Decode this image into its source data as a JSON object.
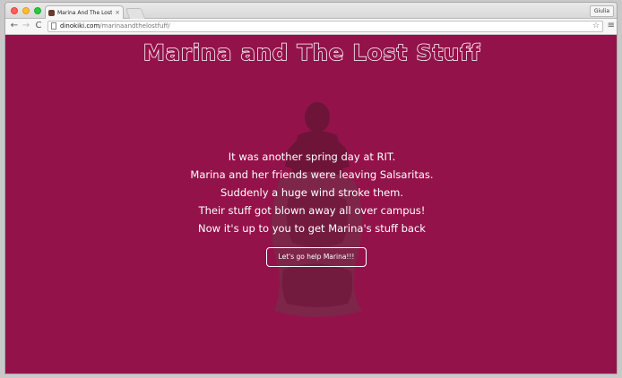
{
  "browser": {
    "tab_title": "Marina And The Lost Stuff",
    "tab_close": "×",
    "profile_name": "Giulia",
    "url_domain": "dinokiki.com",
    "url_path": "/marinaandthelostfuff/",
    "back_glyph": "←",
    "forward_glyph": "→",
    "reload_glyph": "C",
    "star_glyph": "☆",
    "menu_glyph": "≡"
  },
  "page": {
    "title": "Marina and The Lost Stuff",
    "story_lines": [
      "It was another spring day at RIT.",
      "Marina and her friends were leaving Salsaritas.",
      "Suddenly a huge wind stroke them.",
      "Their stuff got blown away all over campus!",
      "Now it's up to you to get Marina's stuff back"
    ],
    "cta_label": "Let's go help Marina!!!",
    "background_color": "#93124a"
  }
}
